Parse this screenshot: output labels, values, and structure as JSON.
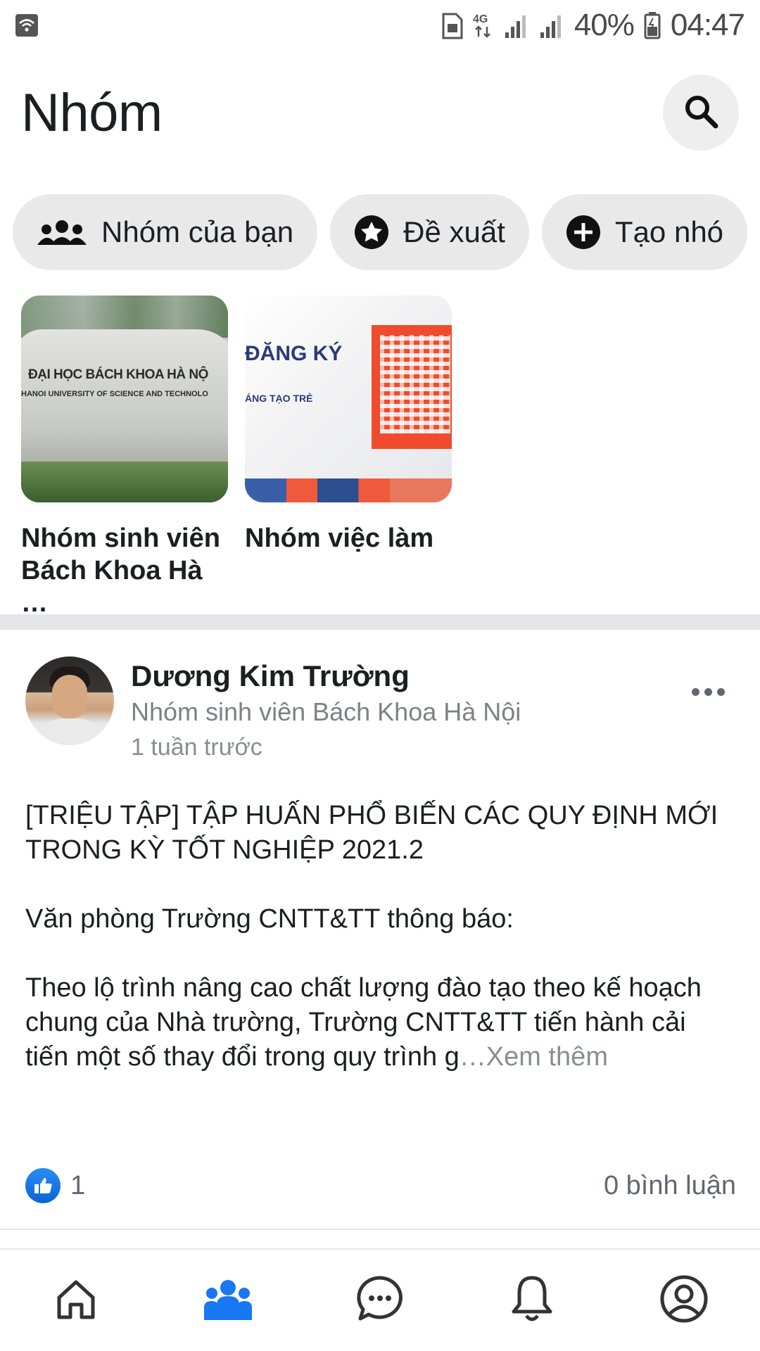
{
  "status_bar": {
    "network": "4G",
    "battery": "40%",
    "time": "04:47"
  },
  "header": {
    "title": "Nhóm"
  },
  "chips": [
    {
      "label": "Nhóm của bạn",
      "icon": "people-icon"
    },
    {
      "label": "Đề xuất",
      "icon": "star-icon"
    },
    {
      "label": "Tạo nhó",
      "icon": "plus-icon"
    }
  ],
  "groups": [
    {
      "name": "Nhóm sinh viên Bách Khoa Hà …",
      "thumb_text_1": "ĐẠI HỌC BÁCH KHOA HÀ NỘ",
      "thumb_text_2": "HANOI UNIVERSITY OF SCIENCE AND TECHNOLO"
    },
    {
      "name": "Nhóm việc làm",
      "thumb_text_1": "ĐĂNG KÝ",
      "thumb_text_2": "ÁNG TẠO TRẺ"
    }
  ],
  "post": {
    "author": "Dương Kim Trường",
    "group": "Nhóm sinh viên Bách Khoa Hà Nội",
    "time": "1 tuần trước",
    "body_1": "[TRIỆU TẬP] TẬP HUẤN PHỔ BIẾN CÁC QUY ĐỊNH MỚI TRONG KỲ TỐT NGHIỆP 2021.2",
    "body_2": "Văn phòng Trường CNTT&TT thông báo:",
    "body_3": "Theo lộ trình nâng cao chất lượng đào tạo theo kế hoạch chung của Nhà trường, Trường CNTT&TT tiến hành cải tiến một số thay đổi trong quy trình g",
    "see_more": "…Xem thêm",
    "likes": "1",
    "comments": "0 bình luận"
  },
  "colors": {
    "accent": "#1877f2",
    "chip_bg": "#e9e9e9",
    "muted_text": "#8a8d91"
  }
}
